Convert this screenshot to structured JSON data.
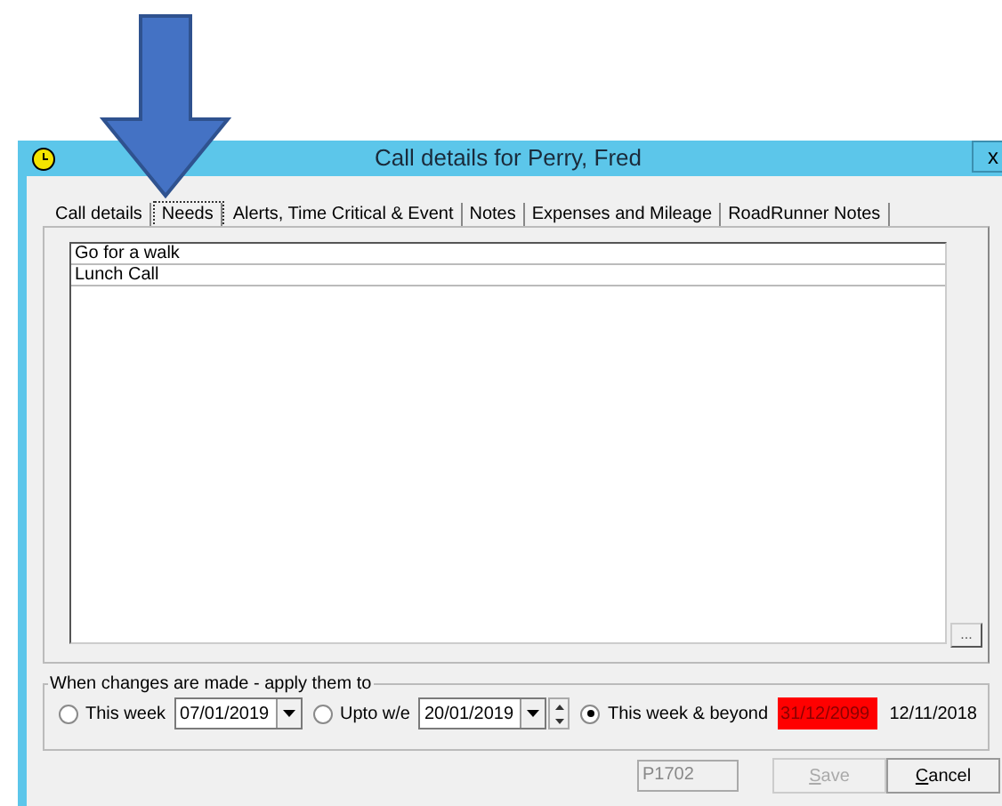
{
  "window": {
    "title": "Call details for Perry, Fred",
    "close": "x"
  },
  "tabs": [
    {
      "label": "Call details",
      "selected": false
    },
    {
      "label": "Needs",
      "selected": true
    },
    {
      "label": "Alerts, Time Critical & Event",
      "selected": false
    },
    {
      "label": "Notes",
      "selected": false
    },
    {
      "label": "Expenses and Mileage",
      "selected": false
    },
    {
      "label": "RoadRunner Notes",
      "selected": false
    }
  ],
  "needs": [
    "Go for a walk",
    "Lunch Call"
  ],
  "more_button": "...",
  "apply_group": {
    "title": "When changes are made - apply them to",
    "options": [
      {
        "label": "This week",
        "selected": false,
        "date": "07/01/2019",
        "kind": "dropdown",
        "highlighted": false
      },
      {
        "label": "Upto w/e",
        "selected": false,
        "date": "20/01/2019",
        "kind": "spin",
        "highlighted": false
      },
      {
        "label": "This week & beyond",
        "selected": true,
        "date": "31/12/2099",
        "kind": "plain",
        "highlighted": true
      }
    ],
    "created": "12/11/2018"
  },
  "footer": {
    "code": "P1702",
    "buttons": [
      {
        "label": "Save",
        "disabled": true
      },
      {
        "label": "Cancel",
        "disabled": false
      }
    ]
  }
}
